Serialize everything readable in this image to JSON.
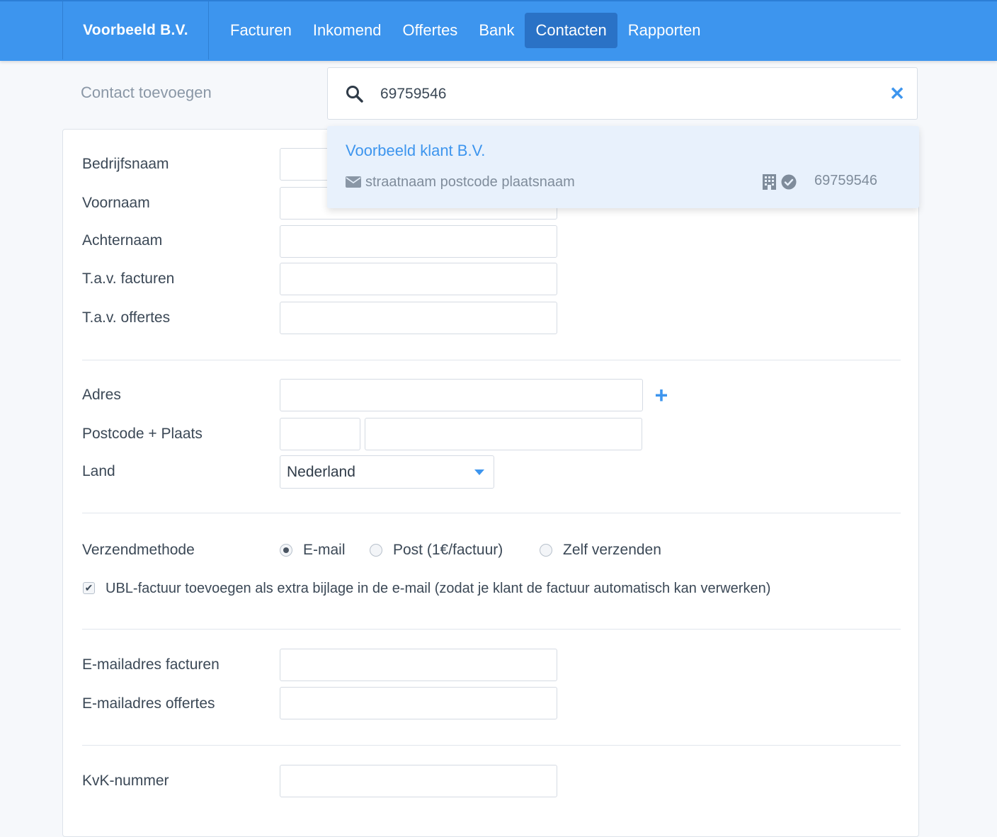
{
  "header": {
    "brand": "Voorbeeld B.V.",
    "nav": [
      {
        "label": "Facturen"
      },
      {
        "label": "Inkomend"
      },
      {
        "label": "Offertes"
      },
      {
        "label": "Bank"
      },
      {
        "label": "Contacten",
        "active": true
      },
      {
        "label": "Rapporten"
      }
    ]
  },
  "page": {
    "title": "Contact toevoegen"
  },
  "search": {
    "value": "69759546",
    "icon": "search-icon",
    "clear_icon": "close-icon"
  },
  "search_result": {
    "name": "Voorbeeld klant B.V.",
    "address": "straatnaam postcode plaatsnaam",
    "kvk": "69759546",
    "icons": [
      "mail-icon",
      "building-icon",
      "verified-check-icon"
    ]
  },
  "form": {
    "company_name": "Bedrijfsnaam",
    "first_name": "Voornaam",
    "last_name": "Achternaam",
    "attn_invoices": "T.a.v. facturen",
    "attn_quotes": "T.a.v. offertes",
    "address": "Adres",
    "postcode_city": "Postcode + Plaats",
    "country": "Land",
    "country_value": "Nederland",
    "send_method": "Verzendmethode",
    "send_options": [
      {
        "label": "E-mail",
        "checked": true
      },
      {
        "label": "Post (1€/factuur)",
        "checked": false
      },
      {
        "label": "Zelf verzenden",
        "checked": false
      }
    ],
    "ubl_checkbox": {
      "label": "UBL-factuur toevoegen als extra bijlage in de e-mail (zodat je klant de factuur automatisch kan verwerken)",
      "checked": true
    },
    "email_invoices": "E-mailadres facturen",
    "email_quotes": "E-mailadres offertes",
    "kvk_number": "KvK-nummer"
  },
  "colors": {
    "primary": "#3d95ee",
    "nav_active": "#2a72c6",
    "dropdown_bg": "#e8f1fc"
  }
}
